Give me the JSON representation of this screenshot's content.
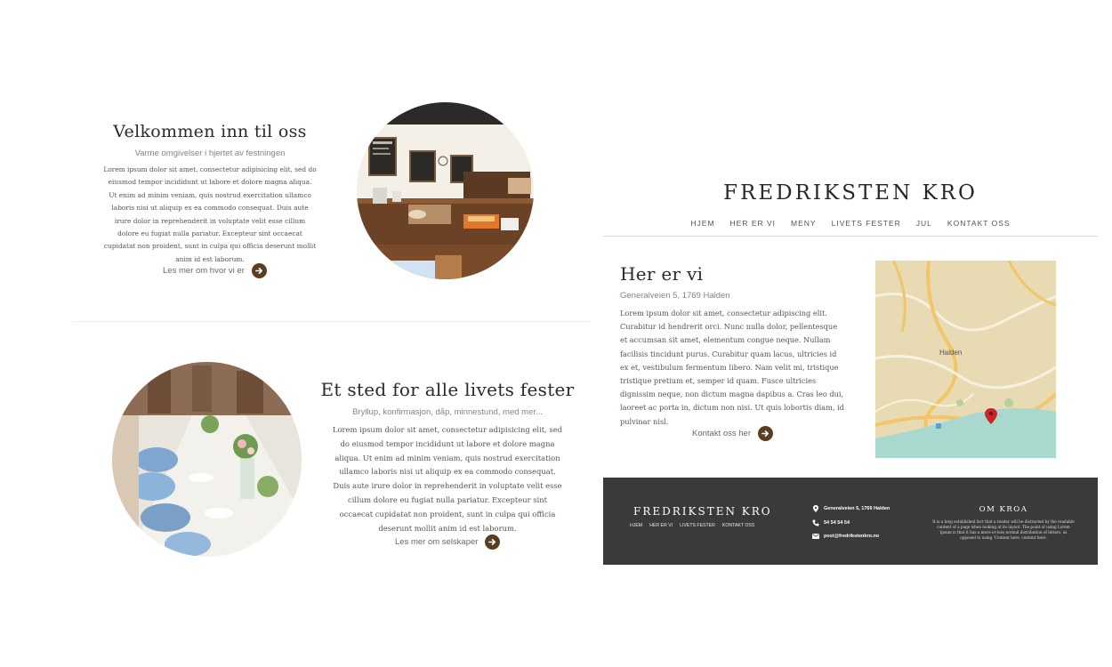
{
  "colors": {
    "accent": "#5b3d22",
    "footer_bg": "#3a3a3a",
    "text_dark": "#2e2925",
    "text_muted": "#8a8380",
    "map_pin": "#c62828"
  },
  "left": {
    "section1": {
      "title": "Velkommen inn til oss",
      "subtitle": "Varme omgivelser i hjertet av festningen",
      "body": "Lorem ipsum dolor sit amet, consectetur adipisicing elit, sed do eiusmod tempor incididunt ut labore et dolore magna aliqua. Ut enim ad minim veniam, quis nostrud exercitation ullamco laboris nisi ut aliquip ex ea commodo consequat. Duis aute irure dolor in reprehenderit in voluptate velit esse cillum dolore eu fugiat nulla pariatur. Excepteur sint occaecat cupidatat non proident, sunt in culpa qui officia deserunt mollit anim id est laborum.",
      "link_label": "Les mer om hvor vi er",
      "link_icon": "arrow-right-icon"
    },
    "section2": {
      "title": "Et sted for alle livets fester",
      "subtitle": "Bryllup, konfirmasjon, dåp, minnestund, med mer...",
      "body": "Lorem ipsum dolor sit amet, consectetur adipisicing elit, sed do eiusmod tempor incididunt ut labore et dolore magna aliqua. Ut enim ad minim veniam, quis nostrud exercitation ullamco laboris nisi ut aliquip ex ea commodo consequat. Duis aute irure dolor in reprehenderit in voluptate velit esse cillum dolore eu fugiat nulla pariatur. Excepteur sint occaecat cupidatat non proident, sunt in culpa qui officia deserunt mollit anim id est laborum.",
      "link_label": "Les mer om selskaper",
      "link_icon": "arrow-right-icon"
    }
  },
  "right": {
    "brand": "FREDRIKSTEN KRO",
    "nav": [
      "HJEM",
      "HER ER VI",
      "MENY",
      "LIVETS FESTER",
      "JUL",
      "KONTAKT OSS"
    ],
    "here": {
      "title": "Her er vi",
      "address": "Generalveien 5, 1769 Halden",
      "body": "Lorem ipsum dolor sit amet, consectetur adipiscing elit. Curabitur id hendrerit orci. Nunc nulla dolor, pellentesque et accumsan sit amet, elementum congue neque. Nullam facilisis tincidunt purus. Curabitur quam lacus, ultricies id ex et, vestibulum fermentum libero. Nam velit mi, tristique tristique pretium et, semper id quam. Fusce ultricies dignissim neque, non dictum magna dapibus a. Cras leo dui, laoreet ac porta in, dictum non nisi. Ut quis lobortis diam, id pulvinar nisl.",
      "link_label": "Kontakt oss her",
      "map_city_label": "Halden"
    },
    "footer": {
      "brand": "FREDRIKSTEN KRO",
      "nav": [
        "HJEM",
        "HER ER VI",
        "LIVETS FESTER",
        "KONTAKT OSS"
      ],
      "address": "Generalveien 5, 1769 Halden",
      "phone": "54 54 54 54",
      "email": "post@fredrikstenkro.no",
      "about_title": "OM KROA",
      "about_text": "It is a long established fact that a reader will be distracted by the readable content of a page when looking at its layout. The point of using Lorem Ipsum is that it has a more-or-less normal distribution of letters, as opposed to using 'Content here, content here."
    }
  }
}
